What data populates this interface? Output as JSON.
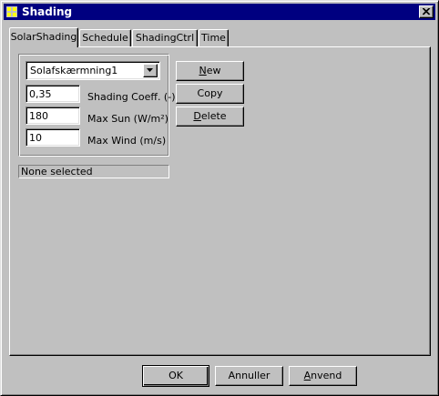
{
  "window": {
    "title": "Shading"
  },
  "tabs": [
    "SolarShading",
    "Schedule",
    "ShadingCtrl",
    "Time"
  ],
  "shading": {
    "selected": "Solafskærmning1",
    "fields": [
      {
        "value": "0,35",
        "label": "Shading Coeff. (-)"
      },
      {
        "value": "180",
        "label": "Max Sun (W/m²)"
      },
      {
        "value": "10",
        "label": "Max Wind (m/s)"
      }
    ],
    "status": "None selected"
  },
  "side_buttons": {
    "new": {
      "first": "N",
      "rest": "ew"
    },
    "copy": "Copy",
    "delete": {
      "first": "D",
      "rest": "elete"
    }
  },
  "footer": {
    "ok": "OK",
    "cancel": "Annuller",
    "apply": {
      "first": "A",
      "rest": "nvend"
    }
  }
}
